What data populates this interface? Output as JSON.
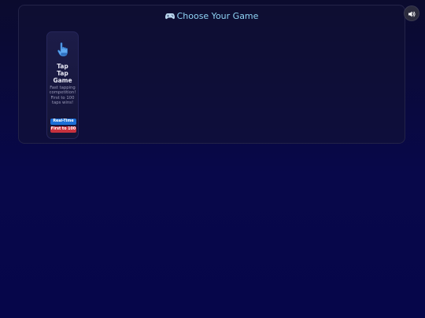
{
  "header": {
    "title": "Choose Your Game",
    "title_icon": "gamepad-icon"
  },
  "controls": {
    "sound_icon": "speaker-icon"
  },
  "games": [
    {
      "icon": "pointing-hand-icon",
      "title_lines": [
        "Tap",
        "Tap",
        "Game"
      ],
      "description_lines": [
        "Fast tapping",
        "competition!",
        "First to 100",
        "taps wins!"
      ],
      "badges": [
        {
          "label": "Real-Time",
          "color": "#1b6ed6"
        },
        {
          "label": "First to 100",
          "color": "#c8323e"
        }
      ]
    }
  ],
  "colors": {
    "accent": "#8fd3f4",
    "background": "#08084a",
    "card": "#1c1c48"
  }
}
